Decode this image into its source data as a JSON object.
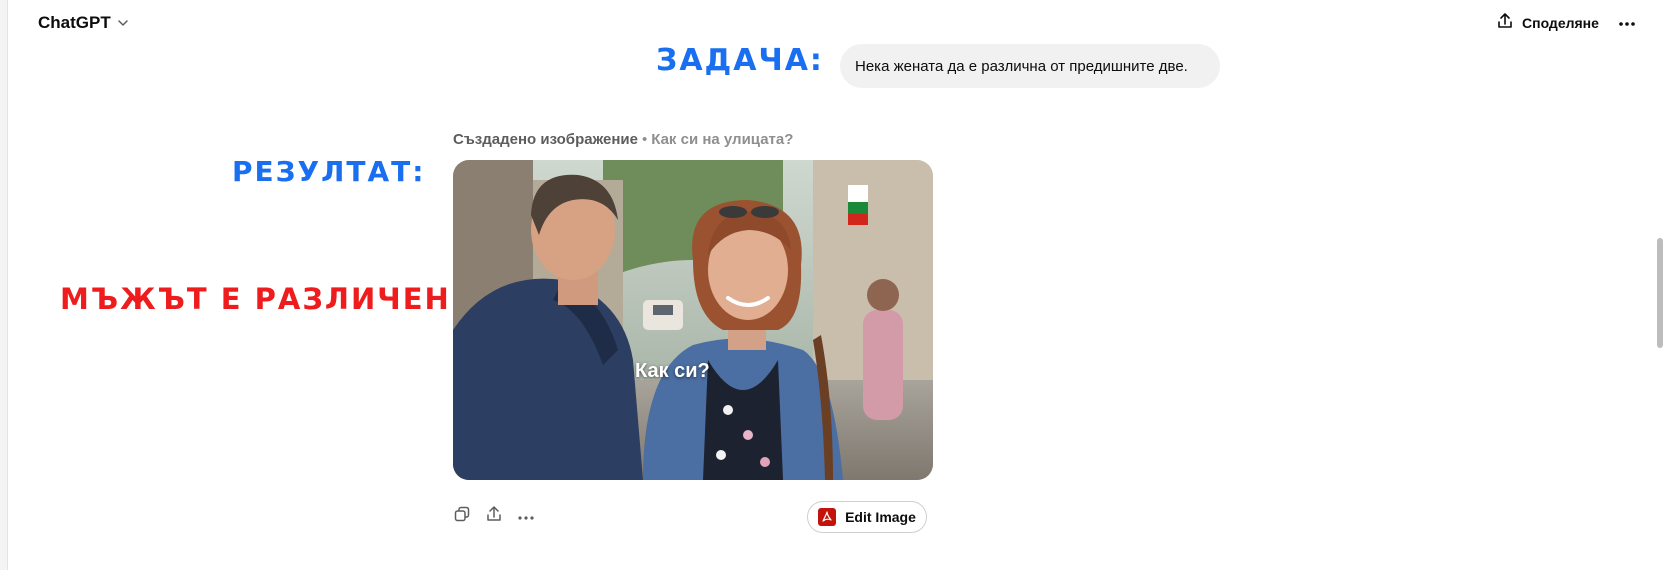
{
  "header": {
    "model_name": "ChatGPT",
    "share_label": "Споделяне",
    "icons": {
      "chevron": "chevron-down-icon",
      "share": "share-upload-icon",
      "more": "more-horizontal-icon"
    }
  },
  "annotations": {
    "task_label": "ЗАДАЧА:",
    "result_label": "РЕЗУЛТАТ:",
    "difference_note": "МЪЖЪТ Е РАЗЛИЧЕН!",
    "colors": {
      "blue": "#1a6ff0",
      "red": "#ee1c1c"
    }
  },
  "conversation": {
    "user_message": "Нека жената да е различна от предишните две.",
    "generated_image": {
      "label": "Създадено изображение",
      "separator": "•",
      "caption": "Как си на улицата?",
      "overlay_text": "Как си?"
    },
    "actions": {
      "icons": [
        "copy-icon",
        "share-icon",
        "more-horizontal-icon"
      ],
      "edit_image_label": "Edit Image",
      "edit_image_icon": "pdf-acrobat-icon"
    }
  }
}
